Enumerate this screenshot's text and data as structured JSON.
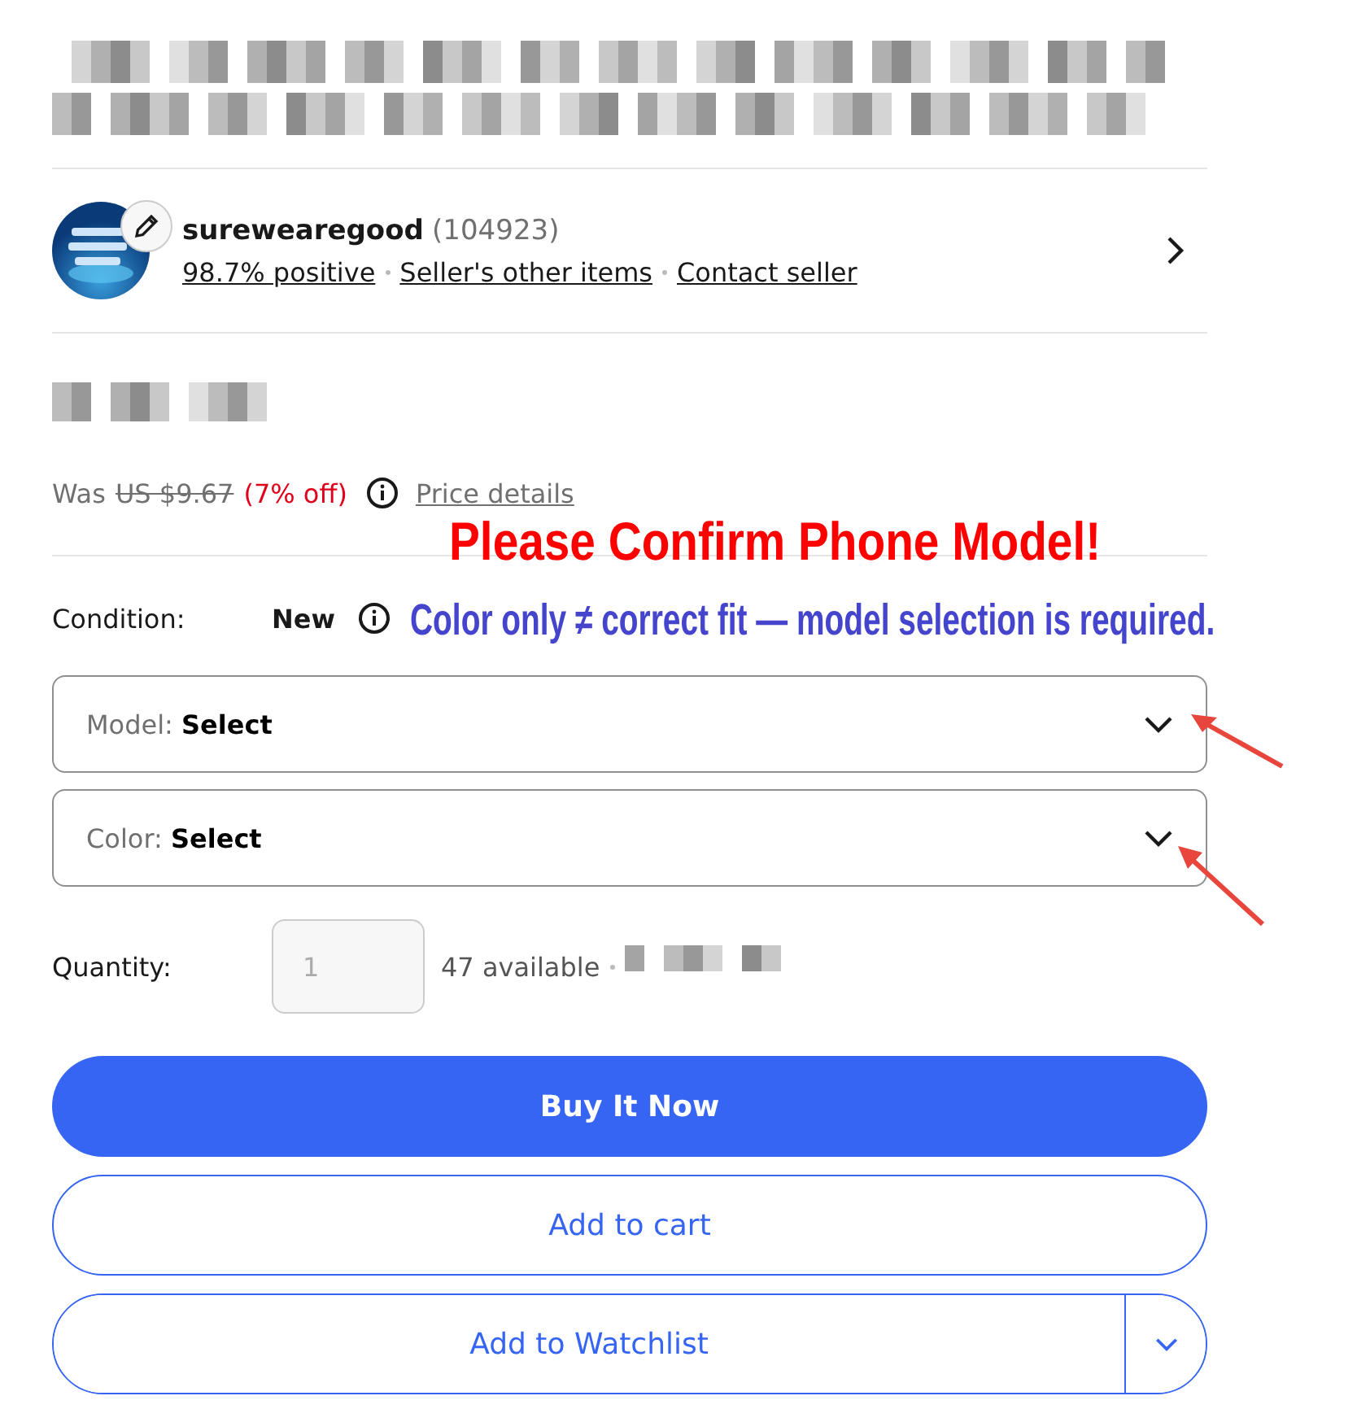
{
  "seller": {
    "name": "surewearegood",
    "feedback_count": "(104923)",
    "links": [
      "98.7% positive",
      "Seller's other items",
      "Contact seller"
    ]
  },
  "price": {
    "was_label": "Was",
    "was_price": "US $9.67",
    "discount": "(7% off)",
    "details_link": "Price details"
  },
  "condition": {
    "label": "Condition:",
    "value": "New"
  },
  "selects": [
    {
      "label": "Model:",
      "value": "Select"
    },
    {
      "label": "Color:",
      "value": "Select"
    }
  ],
  "quantity": {
    "label": "Quantity:",
    "value": "1",
    "available": "47 available"
  },
  "buttons": [
    {
      "label": "Buy It Now",
      "kind": "primary"
    },
    {
      "label": "Add to cart",
      "kind": "secondary"
    },
    {
      "label": "Add to Watchlist",
      "kind": "split"
    }
  ],
  "annotation": {
    "headline": "Please Confirm Phone Model!",
    "note": "Color only ≠ correct fit — model selection is required."
  }
}
